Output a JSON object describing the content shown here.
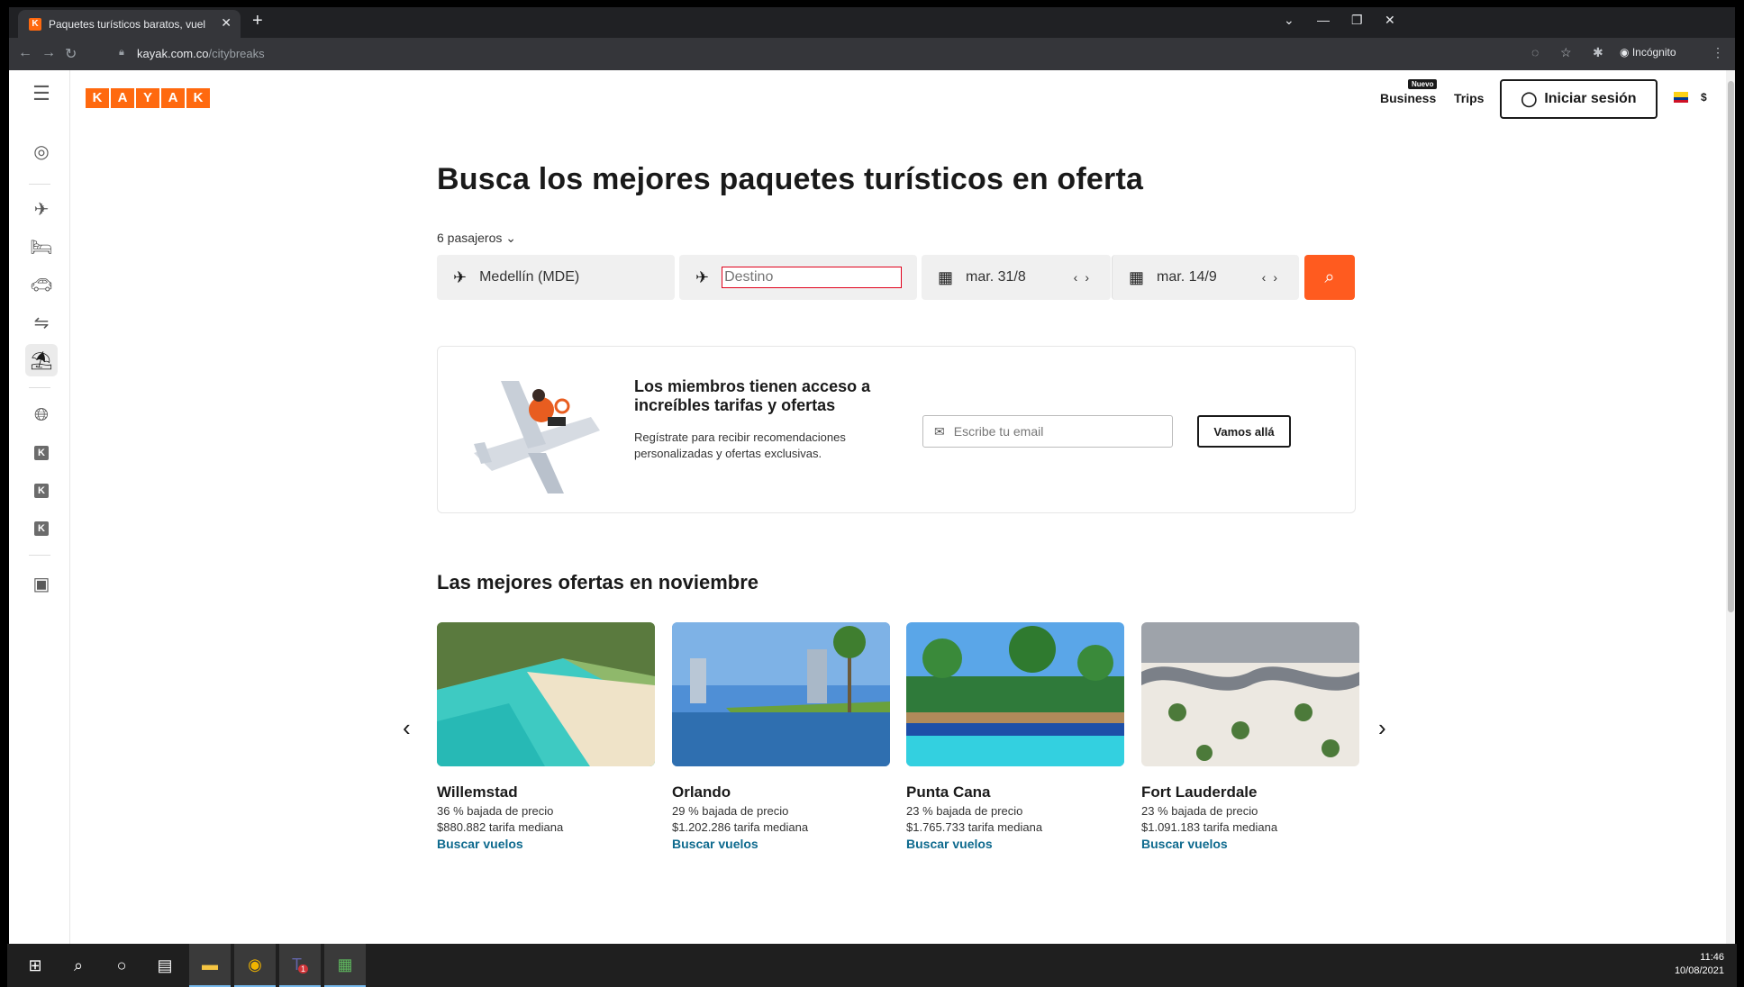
{
  "browser": {
    "tab_title": "Paquetes turísticos baratos, vuel",
    "tab_favicon": "K",
    "url_host": "kayak.com.co",
    "url_path": "/citybreaks",
    "incognito_label": "Incógnito"
  },
  "header": {
    "logo_letters": [
      "K",
      "A",
      "Y",
      "A",
      "K"
    ],
    "business_label": "Business",
    "nuevo_badge": "Nuevo",
    "trips_label": "Trips",
    "signin_label": "Iniciar sesión",
    "currency": "$"
  },
  "hero": {
    "title": "Busca los mejores paquetes turísticos en oferta",
    "passengers": "6 pasajeros"
  },
  "search": {
    "origin": "Medellín (MDE)",
    "destination_placeholder": "Destino",
    "depart_date": "mar. 31/8",
    "return_date": "mar. 14/9"
  },
  "members": {
    "title": "Los miembros tienen acceso a increíbles tarifas y ofertas",
    "body": "Regístrate para recibir recomendaciones personalizadas y ofertas exclusivas.",
    "email_placeholder": "Escribe tu email",
    "cta": "Vamos allá"
  },
  "deals": {
    "title": "Las mejores ofertas en noviembre",
    "items": [
      {
        "name": "Willemstad",
        "drop": "36 % bajada de precio",
        "fare": "$880.882 tarifa mediana",
        "cta": "Buscar vuelos"
      },
      {
        "name": "Orlando",
        "drop": "29 % bajada de precio",
        "fare": "$1.202.286 tarifa mediana",
        "cta": "Buscar vuelos"
      },
      {
        "name": "Punta Cana",
        "drop": "23 % bajada de precio",
        "fare": "$1.765.733 tarifa mediana",
        "cta": "Buscar vuelos"
      },
      {
        "name": "Fort Lauderdale",
        "drop": "23 % bajada de precio",
        "fare": "$1.091.183 tarifa mediana",
        "cta": "Buscar vuelos"
      }
    ]
  },
  "taskbar": {
    "time": "11:46",
    "date": "10/08/2021",
    "teams_badge": "1"
  },
  "colors": {
    "brand": "#ff690f",
    "search_button": "#ff5b1f",
    "link": "#0e6a8e"
  }
}
